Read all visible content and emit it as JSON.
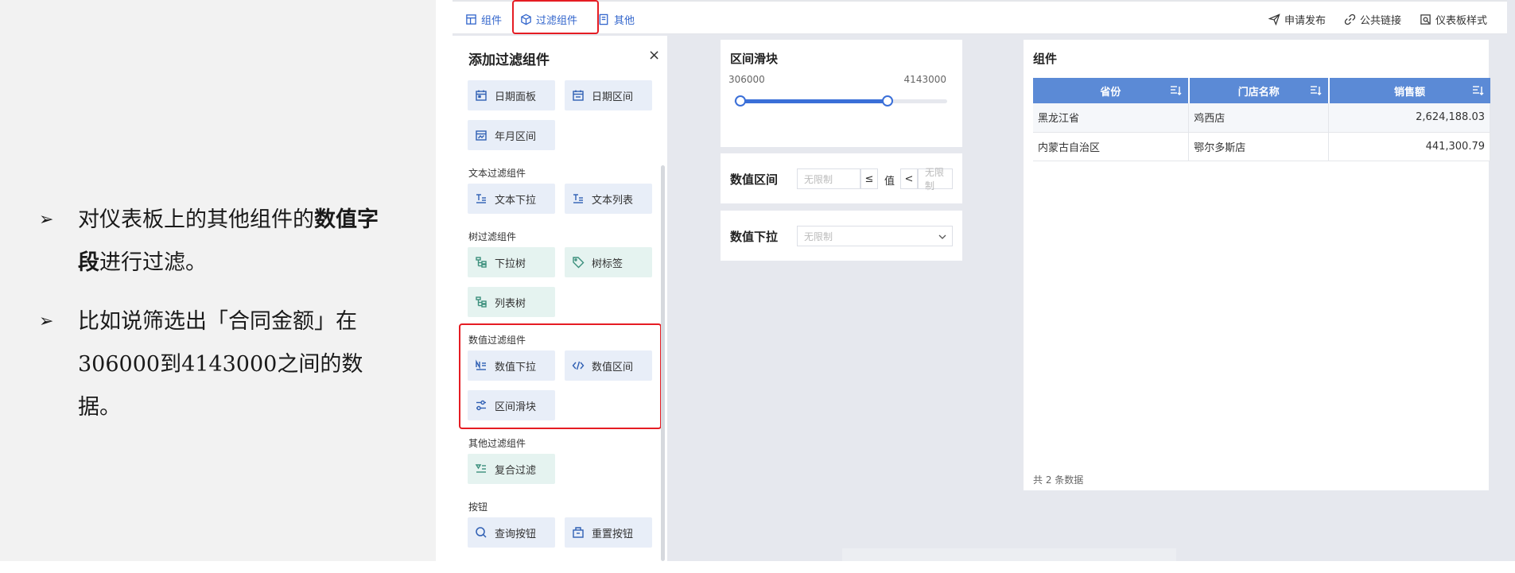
{
  "explanation": {
    "bullet1": {
      "prefix": "对仪表板上的其他组件的",
      "bold": "数值字段",
      "suffix": "进行过滤。"
    },
    "bullet2": {
      "prefix": "比如说筛选出「合同金额」在306000到4143000之间的数据。"
    },
    "arrow_glyph": "➢"
  },
  "toolbar": {
    "tab_components": "组件",
    "tab_filter": "过滤组件",
    "tab_other": "其他",
    "apply_publish": "申请发布",
    "public_link": "公共链接",
    "dashboard_style": "仪表板样式"
  },
  "filter_panel": {
    "title": "添加过滤组件",
    "close": "×",
    "date_buttons": [
      "日期面板",
      "日期区间",
      "年月区间"
    ],
    "text_group": "文本过滤组件",
    "text_buttons": [
      "文本下拉",
      "文本列表"
    ],
    "tree_group": "树过滤组件",
    "tree_buttons": [
      "下拉树",
      "树标签",
      "列表树"
    ],
    "number_group": "数值过滤组件",
    "number_buttons": [
      "数值下拉",
      "数值区间",
      "区间滑块"
    ],
    "other_group": "其他过滤组件",
    "other_buttons": [
      "复合过滤"
    ],
    "button_group": "按钮",
    "button_buttons": [
      "查询按钮",
      "重置按钮"
    ]
  },
  "range_slider": {
    "title": "区间滑块",
    "min_value": "306000",
    "max_value": "4143000",
    "slider_start_fraction": 0.03,
    "slider_end_fraction": 0.72
  },
  "number_range": {
    "label": "数值区间",
    "placeholder_left": "无限制",
    "op_left": "≤",
    "value_label": "值",
    "op_right": "<",
    "placeholder_right": "无限制"
  },
  "number_dropdown": {
    "label": "数值下拉",
    "placeholder": "无限制"
  },
  "table_widget": {
    "title": "组件",
    "headers": [
      "省份",
      "门店名称",
      "销售额"
    ],
    "rows": [
      [
        "黑龙江省",
        "鸡西店",
        "2,624,188.03"
      ],
      [
        "内蒙古自治区",
        "鄂尔多斯店",
        "441,300.79"
      ]
    ],
    "footer": "共 2 条数据"
  },
  "colors": {
    "accent": "#3366cc",
    "header_blue": "#5b8ad6",
    "highlight_red": "#e51c23"
  }
}
